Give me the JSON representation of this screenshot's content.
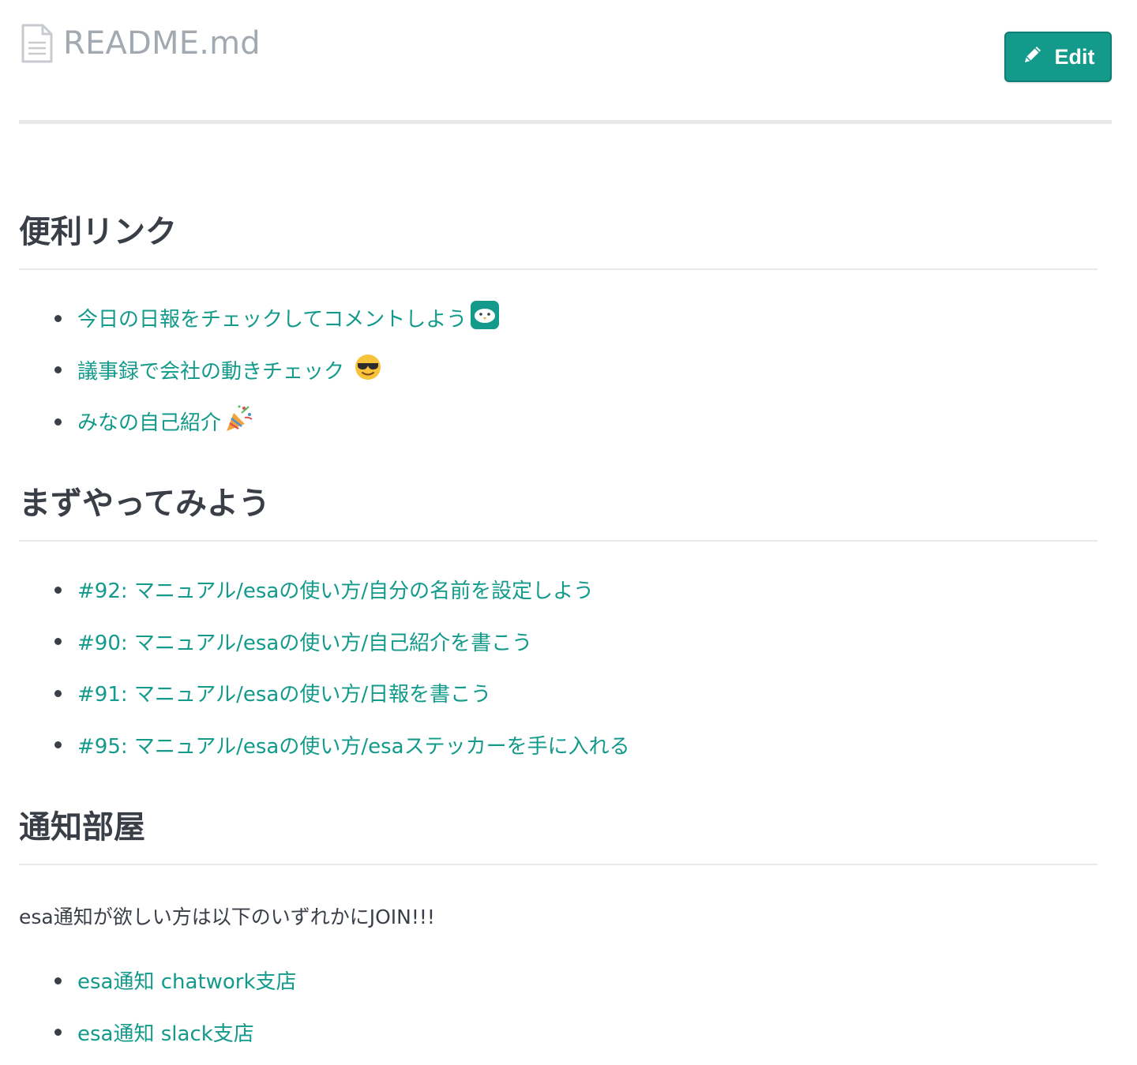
{
  "header": {
    "file_name": "README.md",
    "edit_label": "Edit"
  },
  "sections": [
    {
      "heading": "便利リンク",
      "links": [
        {
          "text": "今日の日報をチェックしてコメントしよう",
          "emoji": "esa-bird-icon"
        },
        {
          "text": "議事録で会社の動きチェック",
          "emoji": "sunglasses-emoji"
        },
        {
          "text": "みなの自己紹介",
          "emoji": "party-popper-emoji"
        }
      ]
    },
    {
      "heading": "まずやってみよう",
      "links": [
        {
          "text": "#92: マニュアル/esaの使い方/自分の名前を設定しよう"
        },
        {
          "text": "#90: マニュアル/esaの使い方/自己紹介を書こう"
        },
        {
          "text": "#91: マニュアル/esaの使い方/日報を書こう"
        },
        {
          "text": "#95: マニュアル/esaの使い方/esaステッカーを手に入れる"
        }
      ]
    },
    {
      "heading": "通知部屋",
      "intro": "esa通知が欲しい方は以下のいずれかにJOIN!!!",
      "links": [
        {
          "text": "esa通知 chatwork支店"
        },
        {
          "text": "esa通知 slack支店"
        }
      ]
    }
  ],
  "colors": {
    "accent": "#139a8b",
    "text": "#3a3f47",
    "muted": "#a3a9b1",
    "divider": "#e6e7e9"
  }
}
